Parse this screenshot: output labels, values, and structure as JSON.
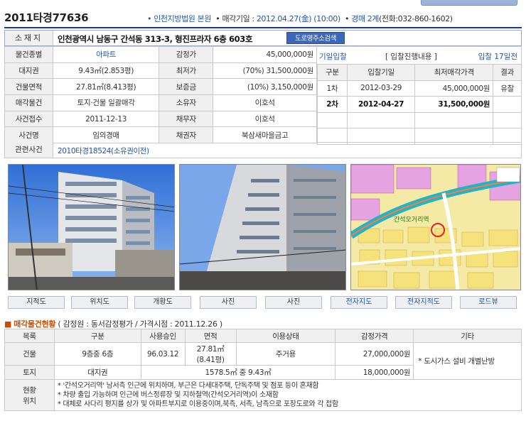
{
  "case_number": "2011타경77636",
  "header": {
    "court": "인천지방법원 본원",
    "sale_date_label": "매각기일 : ",
    "sale_date": "2012.04.27(金) (10:00)",
    "dept": "경매 2계",
    "phone": "(전화:032-860-1602)"
  },
  "address": {
    "label": "소재지",
    "value": "인천광역시 남동구 간석동 313-3, 형진프라자 6층 603호",
    "button": "도로명주소검색"
  },
  "info_rows": [
    {
      "l1": "물건종별",
      "v1": "아파트",
      "l2": "감정가",
      "v2": "45,000,000원"
    },
    {
      "l1": "대지권",
      "v1": "9.43㎡(2.853평)",
      "l2": "최저가",
      "v2": "(70%) 31,500,000원"
    },
    {
      "l1": "건물면적",
      "v1": "27.81㎡(8.413평)",
      "l2": "보증금",
      "v2": "(10%) 3,150,000원"
    },
    {
      "l1": "매각물건",
      "v1": "토지·건물 일괄매각",
      "l2": "소유자",
      "v2": "이호석"
    },
    {
      "l1": "사건접수",
      "v1": "2011-12-13",
      "l2": "채무자",
      "v2": "이호석"
    },
    {
      "l1": "사건명",
      "v1": "임의경매",
      "l2": "채권자",
      "v2": "북삼새마을금고"
    }
  ],
  "bid_panel": {
    "left": "기일입찰",
    "center": "[ 입찰진행내용 ]",
    "right": "입찰 17일전",
    "headers": [
      "구분",
      "입찰기일",
      "최저매각가격",
      "결과"
    ],
    "rows": [
      {
        "round": "1차",
        "date": "2012-03-29",
        "price": "45,000,000원",
        "result": "유찰"
      },
      {
        "round": "2차",
        "date": "2012-04-27",
        "price": "31,500,000원",
        "result": ""
      }
    ]
  },
  "related": {
    "label": "관련사건",
    "value": "2010타경18524(소유권이전)"
  },
  "tabs": [
    "지적도",
    "위치도",
    "개황도",
    "사진",
    "사진",
    "전자지도",
    "전자지적도",
    "로드뷰"
  ],
  "section": {
    "title": "매각물건현황",
    "info": "( 감정원 : 동서감정평가 / 가격시점 : 2011.12.26 )"
  },
  "detail": {
    "headers": [
      "목록",
      "구분",
      "사용승인",
      "면적",
      "이용상태",
      "감정가격",
      "기타"
    ],
    "building": {
      "label": "건물",
      "type": "9층중 6층",
      "approval": "96.03.12",
      "area1": "27.81㎡",
      "area2": "(8.41평)",
      "use": "주거용",
      "price": "27,000,000원"
    },
    "land": {
      "label": "토지",
      "type": "대지권",
      "area": "1578.5㎡ 중 9.43㎡",
      "price": "18,000,000원"
    },
    "other": "* 도시가스 설비 개별난방",
    "status_label1": "현황",
    "status_label2": "위치",
    "notes": [
      "* '간석오거리역' 남서측 인근에 위치하며, 부근은 다세대주택, 단독주택 및 점포 등이 혼재함",
      "* 차량 출입 가능하며 인근에 버스정류장 및 지하철역(간석오거리역)이 소재함",
      "* 대체로 사다리 평지를 상가 및 아파트부지로 이용중이며,북측, 서측, 남측으로 포장도로와 각 접함"
    ]
  },
  "colors": {
    "accent": "#2255aa",
    "navy": "#1d3a8a",
    "orange": "#c84d00"
  }
}
